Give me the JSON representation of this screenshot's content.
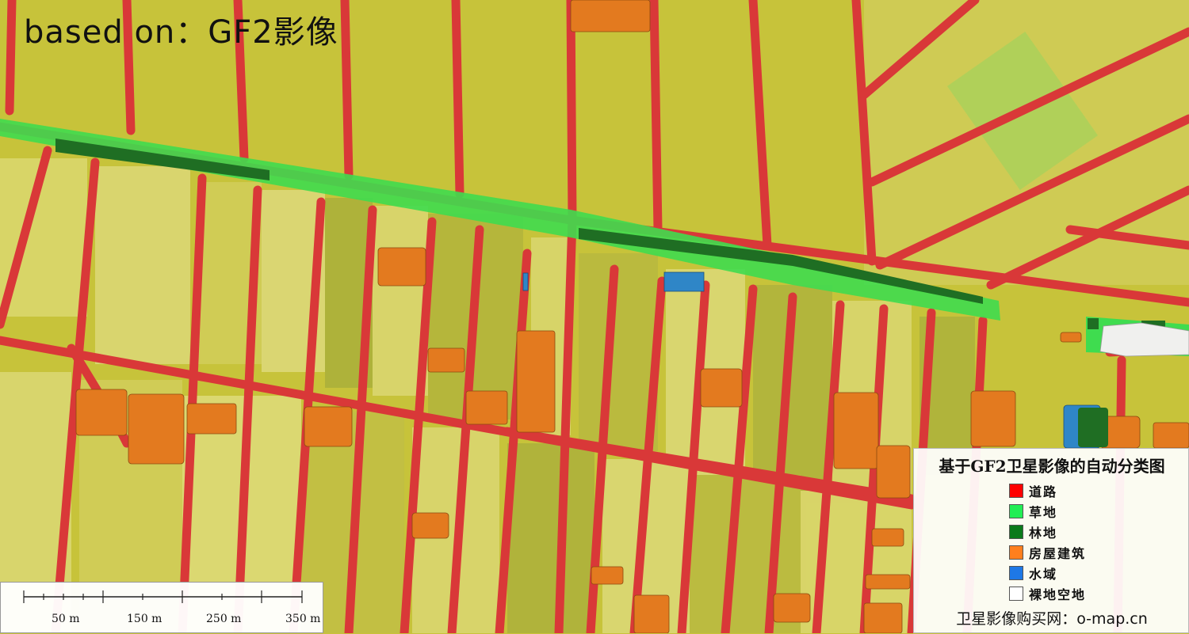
{
  "overlay": {
    "title": "based on：GF2影像"
  },
  "legend": {
    "title": "基于GF2卫星影像的自动分类图",
    "items": [
      {
        "label": "道路",
        "color": "#ff0000"
      },
      {
        "label": "草地",
        "color": "#22ee55"
      },
      {
        "label": "林地",
        "color": "#0a7a1a"
      },
      {
        "label": "房屋建筑",
        "color": "#ff7f1e"
      },
      {
        "label": "水域",
        "color": "#1e78e6"
      },
      {
        "label": "裸地空地",
        "color": "#ffffff"
      }
    ],
    "footer": "卫星影像购买网：o-map.cn"
  },
  "scalebar": {
    "labels": [
      "50 m",
      "150 m",
      "250 m",
      "350 m"
    ]
  },
  "map_colors": {
    "field": "#c7c33a",
    "field_light": "#e3e08a",
    "road": "#d93838",
    "grass": "#3fdc4f",
    "forest": "#1f6e23",
    "building": "#e37a1f",
    "water": "#2f86c7",
    "bare": "#f0f0ee"
  }
}
